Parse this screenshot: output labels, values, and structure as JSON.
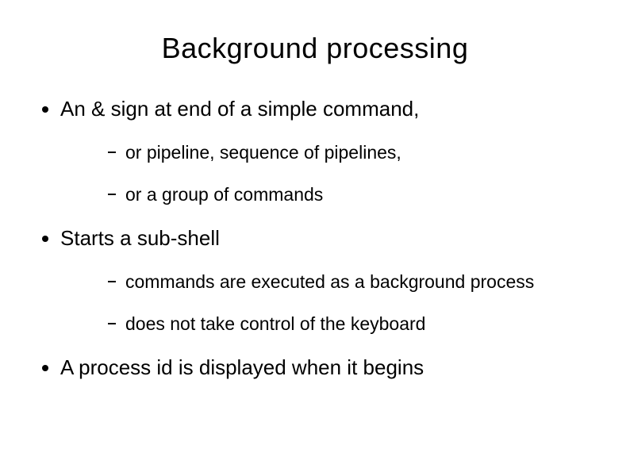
{
  "title": "Background processing",
  "items": [
    {
      "text": "An & sign at end of a simple command,",
      "sub": [
        "or pipeline, sequence of pipelines,",
        "or a group of commands"
      ]
    },
    {
      "text": "Starts a sub-shell",
      "sub": [
        "commands are executed as a background process",
        "does not take control of the keyboard"
      ]
    },
    {
      "text": "A process id is displayed when it begins",
      "sub": []
    }
  ]
}
